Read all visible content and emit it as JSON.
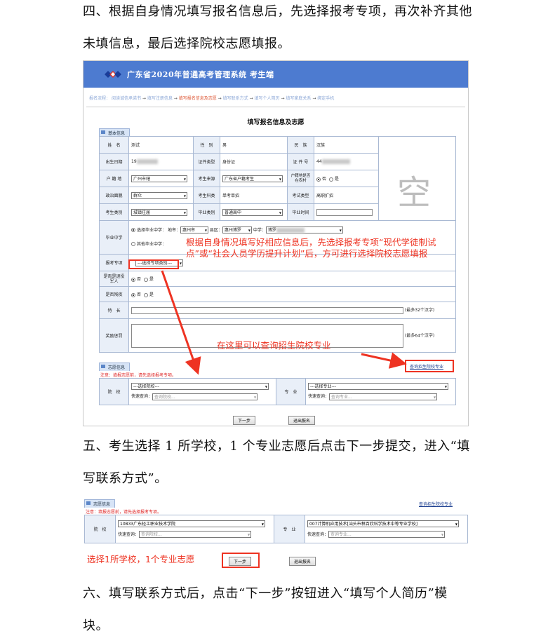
{
  "doc": {
    "p4_line1": "四、根据自身情况填写报名信息后，先选择报考专项，再次补齐其他",
    "p4_line2": "未填信息，最后选择院校志愿填报。",
    "p5_line1": "五、考生选择 1 所学校，1 个专业志愿后点击下一步提交，进入“填",
    "p5_line2": "写联系方式”。",
    "p6_line1": "六、填写联系方式后，点击“下一步”按钮进入“填写个人简历”模",
    "p6_line2": "块。"
  },
  "shot1": {
    "banner_title": "广东省2020年普通高考管理系统  考生端",
    "steps": {
      "prefix": "报名流程：",
      "s1": "阅读诚信承诺书",
      "s2": "填写注册信息",
      "s3": "填写报名信息及志愿",
      "s4": "填写联系方式",
      "s5": "填写个人简历",
      "s6": "填写家庭关系",
      "s7": "绑定手机",
      "arrow": "→"
    },
    "form_title": "填写报名信息及志愿",
    "basic_section": "基本信息",
    "labels": {
      "name": "姓　名",
      "gender": "性　别",
      "ethnicity": "民　族",
      "birth": "出生日期",
      "id_type": "证件类型",
      "id_no": "证 件 号",
      "hukou": "户 籍 地",
      "source": "考生来源",
      "rural": "户籍地是否在农村",
      "political": "政治面貌",
      "subject": "考生科类",
      "exam_type": "考试类型",
      "cand_type": "考生类别",
      "grad_type": "毕业类别",
      "grad_time": "毕业时间",
      "grad_school": "毕业中学",
      "special": "报考专项",
      "veteran": "是否是退役军人",
      "disabled": "是否残疾",
      "specialty": "特　长",
      "awards": "奖励惩罚"
    },
    "values": {
      "name": "测试",
      "gender": "男",
      "ethnicity": "汉族",
      "birth_prefix": "19",
      "id_type": "身份证",
      "id_prefix": "44",
      "hukou": "广州市辖",
      "source": "广东省户籍考生",
      "rural_no": "否",
      "rural_yes": "是",
      "political": "群众",
      "subject": "单考单招",
      "exam_type": "高职扩招",
      "cand_type": "城镇往届",
      "grad_type": "普通高中",
      "school_radio1": "选择毕业中学：",
      "city_label": "地市：",
      "city": "惠州市",
      "county_label": "县区：",
      "county": "惠州博罗",
      "middle_label": "中学：",
      "middle": "博罗",
      "school_radio2": "其他毕业中学：",
      "special": "---选择专项类别---",
      "no": "否",
      "yes": "是",
      "specialty_hint": "(最多32个汉字)",
      "awards_hint": "(最多64个汉字)"
    },
    "photo_placeholder": "空",
    "annotation_main": "根据自身情况填写好相应信息后，先选择报考专项“现代学徒制试点”或“社会人员学历提升计划”后，方可进行选择院校志愿填报",
    "annotation_query": "在这里可以查询招生院校专业",
    "wish_section": "志愿信息",
    "query_link": "查询招生院校专业",
    "warning": "注意：填报志愿前，请先选择报考专项。",
    "school_label": "院　校",
    "major_label": "专　业",
    "school_select": "---选择院校---",
    "major_select": "---选择专业---",
    "quick_label": "快速查询：",
    "school_search_placeholder": "查询院校...",
    "major_search_placeholder": "查询专业...",
    "next_button": "下一步",
    "exit_button": "退出报名"
  },
  "shot2": {
    "wish_section": "志愿信息",
    "query_link": "查询招生院校专业",
    "warning": "注意：填报志愿前，请先选择报考专项。",
    "school_label": "院　校",
    "major_label": "专　业",
    "school_select": "10833广东轻工职业技术学院",
    "major_select": "007计算机应用技术[汕头市林百欣科学技术中等专业学校]",
    "quick_label": "快速查询：",
    "school_search_placeholder": "查询院校...",
    "major_search_placeholder": "查询专业...",
    "annotation": "选择1所学校，1个专业志愿",
    "next_button": "下一步",
    "exit_button": "退出报名"
  }
}
